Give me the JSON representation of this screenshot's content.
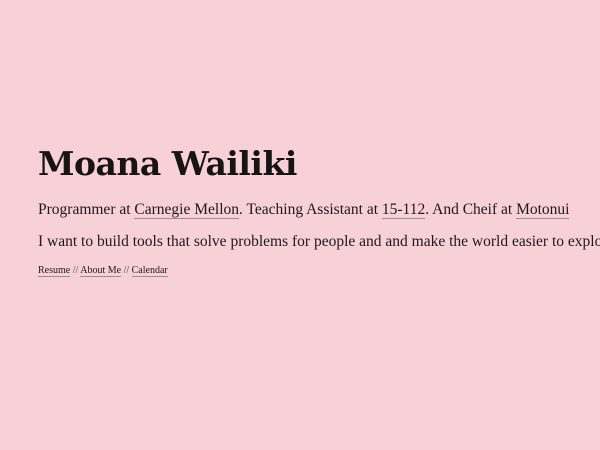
{
  "profile": {
    "name": "Moana Wailiki",
    "bio": {
      "prefix": "Programmer at ",
      "link1": "Carnegie Mellon",
      "mid1": ". Teaching Assistant at ",
      "link2": "15-112",
      "mid2": ". And Cheif at ",
      "link3": "Motonui"
    },
    "mission": "I want to build tools that solve problems for people and and make the world easier to explore."
  },
  "nav": {
    "items": [
      "Resume",
      "About Me",
      "Calendar"
    ],
    "separator": " // "
  },
  "colors": {
    "background": "#f8d0d8",
    "text": "#1c1a1a",
    "link_underline": "#9a8e90"
  }
}
